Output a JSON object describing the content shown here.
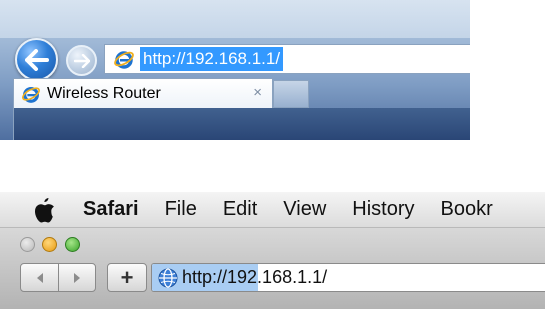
{
  "ie": {
    "address": {
      "url": "http://192.168.1.1/"
    },
    "tab": {
      "title": "Wireless Router",
      "close": "×"
    },
    "colors": {
      "selection": "#3399ff",
      "tab_bg": "#ffffff"
    }
  },
  "safari": {
    "menu": {
      "app": "Safari",
      "items": [
        "File",
        "Edit",
        "View",
        "History",
        "Bookr"
      ]
    },
    "toolbar": {
      "add_label": "+"
    },
    "address": {
      "url": "http://192.168.1.1/",
      "load_progress": 0.27
    },
    "colors": {
      "close": "#cfcfcf",
      "minimize": "#f0a520",
      "zoom": "#4cb535",
      "progress": "#a9cdf3"
    }
  }
}
